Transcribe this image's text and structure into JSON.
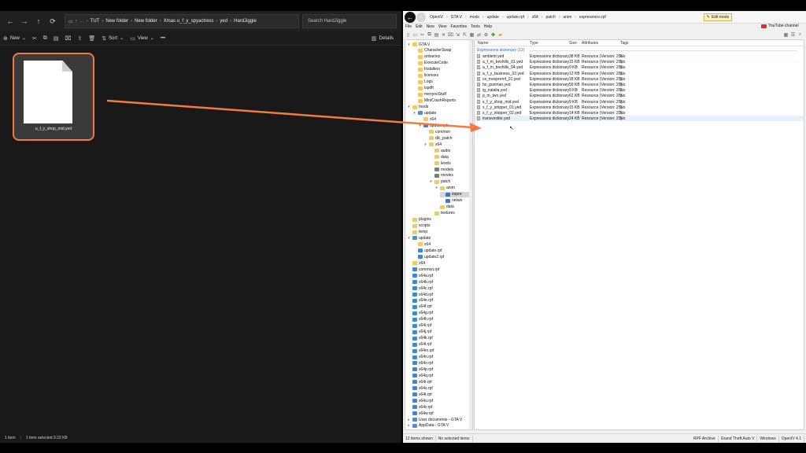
{
  "explorer": {
    "address": [
      "TUT",
      "New folder",
      "New folder",
      "Xmas u_f_y_spyactress",
      "yed",
      "HardJiggle"
    ],
    "search_placeholder": "Search HardJiggle",
    "toolbar": {
      "new": "New",
      "sort": "Sort",
      "view": "View",
      "more": "•••",
      "details": "Details"
    },
    "file": {
      "name": "u_f_y_shop_mid.yed"
    },
    "status": {
      "items": "1 item",
      "selected": "1 item selected  9.22 KB"
    }
  },
  "openiv": {
    "address": [
      "OpenIV",
      "GTA V",
      "mods",
      "update",
      "update.rpf",
      "x64",
      "patch",
      "anim",
      "expressions.rpf"
    ],
    "edit_mode": "Edit mode",
    "menu": [
      "File",
      "Edit",
      "New",
      "View",
      "Favorites",
      "Tools",
      "Help"
    ],
    "youtube": "YouTube channel",
    "tree": [
      {
        "label": "GTA V",
        "depth": 0,
        "icon": "folder",
        "toggle": "▾"
      },
      {
        "label": "CharacterSwap",
        "depth": 1,
        "icon": "folder",
        "toggle": ""
      },
      {
        "label": "artiseries",
        "depth": 1,
        "icon": "folder",
        "toggle": ""
      },
      {
        "label": "ExecuteCode",
        "depth": 1,
        "icon": "folder",
        "toggle": ""
      },
      {
        "label": "Installers",
        "depth": 1,
        "icon": "folder",
        "toggle": ""
      },
      {
        "label": "licenses",
        "depth": 1,
        "icon": "folder",
        "toggle": ""
      },
      {
        "label": "Logs",
        "depth": 1,
        "icon": "folder",
        "toggle": ""
      },
      {
        "label": "lspdfr",
        "depth": 1,
        "icon": "folder",
        "toggle": ""
      },
      {
        "label": "menyooStuff",
        "depth": 1,
        "icon": "folder",
        "toggle": ""
      },
      {
        "label": "MiniCrashReports",
        "depth": 1,
        "icon": "folder",
        "toggle": ""
      },
      {
        "label": "mods",
        "depth": 0,
        "icon": "folder",
        "toggle": "▾"
      },
      {
        "label": "update",
        "depth": 1,
        "icon": "blue",
        "toggle": "▾"
      },
      {
        "label": "x64",
        "depth": 2,
        "icon": "folder",
        "toggle": ""
      },
      {
        "label": "update.rpf",
        "depth": 2,
        "icon": "rpf",
        "toggle": "▾"
      },
      {
        "label": "common",
        "depth": 3,
        "icon": "folder",
        "toggle": ""
      },
      {
        "label": "dlc_patch",
        "depth": 3,
        "icon": "folder",
        "toggle": ""
      },
      {
        "label": "x64",
        "depth": 3,
        "icon": "folder",
        "toggle": "▾"
      },
      {
        "label": "audio",
        "depth": 4,
        "icon": "folder",
        "toggle": ""
      },
      {
        "label": "data",
        "depth": 4,
        "icon": "folder",
        "toggle": ""
      },
      {
        "label": "levels",
        "depth": 4,
        "icon": "folder",
        "toggle": ""
      },
      {
        "label": "models",
        "depth": 4,
        "icon": "ydr",
        "toggle": ""
      },
      {
        "label": "movies",
        "depth": 4,
        "icon": "ydr",
        "toggle": ""
      },
      {
        "label": "patch",
        "depth": 4,
        "icon": "folder",
        "toggle": "▾"
      },
      {
        "label": "anim",
        "depth": 5,
        "icon": "folder",
        "toggle": "▾"
      },
      {
        "label": "expre",
        "depth": 6,
        "icon": "exp",
        "toggle": "",
        "selected": true
      },
      {
        "label": "netwo",
        "depth": 6,
        "icon": "exp",
        "toggle": ""
      },
      {
        "label": "data",
        "depth": 5,
        "icon": "folder",
        "toggle": ""
      },
      {
        "label": "textures",
        "depth": 4,
        "icon": "folder",
        "toggle": ""
      },
      {
        "label": "plugins",
        "depth": 0,
        "icon": "folder",
        "toggle": ""
      },
      {
        "label": "scripts",
        "depth": 0,
        "icon": "folder",
        "toggle": ""
      },
      {
        "label": "temp",
        "depth": 0,
        "icon": "folder",
        "toggle": ""
      },
      {
        "label": "update",
        "depth": 0,
        "icon": "blue",
        "toggle": "▾"
      },
      {
        "label": "x64",
        "depth": 1,
        "icon": "folder",
        "toggle": ""
      },
      {
        "label": "update.rpf",
        "depth": 1,
        "icon": "rpf",
        "toggle": ""
      },
      {
        "label": "update2.rpf",
        "depth": 1,
        "icon": "rpf",
        "toggle": ""
      },
      {
        "label": "x64",
        "depth": 0,
        "icon": "folder",
        "toggle": ""
      },
      {
        "label": "common.rpf",
        "depth": 0,
        "icon": "rpf",
        "toggle": ""
      },
      {
        "label": "x64a.rpf",
        "depth": 0,
        "icon": "rpf",
        "toggle": ""
      },
      {
        "label": "x64b.rpf",
        "depth": 0,
        "icon": "rpf",
        "toggle": ""
      },
      {
        "label": "x64c.rpf",
        "depth": 0,
        "icon": "rpf",
        "toggle": ""
      },
      {
        "label": "x64d.rpf",
        "depth": 0,
        "icon": "rpf",
        "toggle": ""
      },
      {
        "label": "x64e.rpf",
        "depth": 0,
        "icon": "rpf",
        "toggle": ""
      },
      {
        "label": "x64f.rpf",
        "depth": 0,
        "icon": "rpf",
        "toggle": ""
      },
      {
        "label": "x64g.rpf",
        "depth": 0,
        "icon": "rpf",
        "toggle": ""
      },
      {
        "label": "x64h.rpf",
        "depth": 0,
        "icon": "rpf",
        "toggle": ""
      },
      {
        "label": "x64i.rpf",
        "depth": 0,
        "icon": "rpf",
        "toggle": ""
      },
      {
        "label": "x64j.rpf",
        "depth": 0,
        "icon": "rpf",
        "toggle": ""
      },
      {
        "label": "x64k.rpf",
        "depth": 0,
        "icon": "rpf",
        "toggle": ""
      },
      {
        "label": "x64l.rpf",
        "depth": 0,
        "icon": "rpf",
        "toggle": ""
      },
      {
        "label": "x64m.rpf",
        "depth": 0,
        "icon": "rpf",
        "toggle": ""
      },
      {
        "label": "x64n.rpf",
        "depth": 0,
        "icon": "rpf",
        "toggle": ""
      },
      {
        "label": "x64o.rpf",
        "depth": 0,
        "icon": "rpf",
        "toggle": ""
      },
      {
        "label": "x64p.rpf",
        "depth": 0,
        "icon": "rpf",
        "toggle": ""
      },
      {
        "label": "x64q.rpf",
        "depth": 0,
        "icon": "rpf",
        "toggle": ""
      },
      {
        "label": "x64r.rpf",
        "depth": 0,
        "icon": "rpf",
        "toggle": ""
      },
      {
        "label": "x64s.rpf",
        "depth": 0,
        "icon": "rpf",
        "toggle": ""
      },
      {
        "label": "x64t.rpf",
        "depth": 0,
        "icon": "rpf",
        "toggle": ""
      },
      {
        "label": "x64u.rpf",
        "depth": 0,
        "icon": "rpf",
        "toggle": ""
      },
      {
        "label": "x64v.rpf",
        "depth": 0,
        "icon": "rpf",
        "toggle": ""
      },
      {
        "label": "x64w.rpf",
        "depth": 0,
        "icon": "rpf",
        "toggle": ""
      },
      {
        "label": "User documents - GTA V",
        "depth": 0,
        "icon": "blue",
        "toggle": "▸"
      },
      {
        "label": "AppData - GTA V",
        "depth": 0,
        "icon": "blue",
        "toggle": "▸"
      }
    ],
    "list": {
      "columns": [
        "Name",
        "Type",
        "Size",
        "Attributes",
        "Tags"
      ],
      "group": "Expressions dictionary (12)",
      "rows": [
        {
          "name": "ambient.yed",
          "type": "Expressions dictionary",
          "size": "38 KB",
          "attr": "Resource (Version: 25)",
          "tags": "No"
        },
        {
          "name": "a_f_m_bevhills_01.yed",
          "type": "Expressions dictionary",
          "size": "15 KB",
          "attr": "Resource (Version: 25)",
          "tags": "No"
        },
        {
          "name": "a_f_m_bevhills_04.yed",
          "type": "Expressions dictionary",
          "size": "9 KB",
          "attr": "Resource (Version: 25)",
          "tags": "No"
        },
        {
          "name": "a_f_y_business_02.yed",
          "type": "Expressions dictionary",
          "size": "12 KB",
          "attr": "Resource (Version: 25)",
          "tags": "No"
        },
        {
          "name": "cs_movpremf_01.yed",
          "type": "Expressions dictionary",
          "size": "18 KB",
          "attr": "Resource (Version: 25)",
          "tags": "No"
        },
        {
          "name": "hc_gunman.yed",
          "type": "Expressions dictionary",
          "size": "59 KB",
          "attr": "Resource (Version: 25)",
          "tags": "No"
        },
        {
          "name": "ig_natalia.yed",
          "type": "Expressions dictionary",
          "size": "9 KB",
          "attr": "Resource (Version: 25)",
          "tags": "No"
        },
        {
          "name": "p_m_two.yed",
          "type": "Expressions dictionary",
          "size": "62 KB",
          "attr": "Resource (Version: 25)",
          "tags": "No"
        },
        {
          "name": "s_f_y_shop_mid.yed",
          "type": "Expressions dictionary",
          "size": "9 KB",
          "attr": "Resource (Version: 25)",
          "tags": "No"
        },
        {
          "name": "s_f_y_stripper_01.yed",
          "type": "Expressions dictionary",
          "size": "15 KB",
          "attr": "Resource (Version: 25)",
          "tags": "No"
        },
        {
          "name": "s_f_y_stripper_02.yed",
          "type": "Expressions dictionary",
          "size": "14 KB",
          "attr": "Resource (Version: 25)",
          "tags": "No"
        },
        {
          "name": "transvestite.yed",
          "type": "Expressions dictionary",
          "size": "24 KB",
          "attr": "Resource (Version: 25)",
          "tags": "No"
        }
      ]
    },
    "status": {
      "shown": "12 items shown",
      "selected": "No selected items",
      "right": [
        "RPF Archive",
        "Grand Theft Auto V",
        "Windows",
        "OpenIV 4.1"
      ]
    }
  },
  "colors": {
    "annotation": "#f27a45",
    "explorer_bg": "#191919",
    "openiv_bg": "#f0f0f0"
  }
}
